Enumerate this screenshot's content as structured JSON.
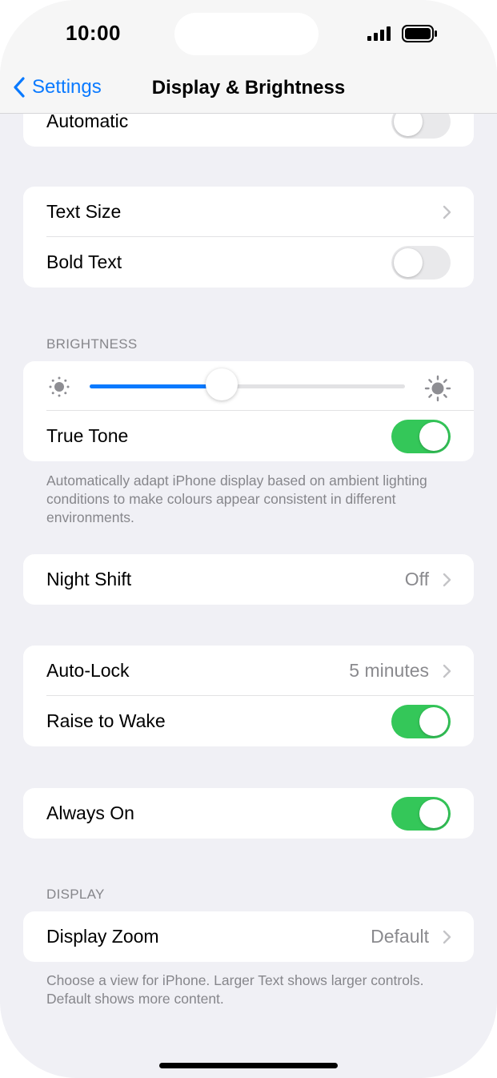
{
  "status_bar": {
    "time": "10:00"
  },
  "nav": {
    "back_label": "Settings",
    "title": "Display & Brightness"
  },
  "rows": {
    "automatic": {
      "label": "Automatic",
      "on": false
    },
    "text_size": {
      "label": "Text Size"
    },
    "bold_text": {
      "label": "Bold Text",
      "on": false
    },
    "true_tone": {
      "label": "True Tone",
      "on": true
    },
    "night_shift": {
      "label": "Night Shift",
      "value": "Off"
    },
    "auto_lock": {
      "label": "Auto-Lock",
      "value": "5 minutes"
    },
    "raise_to_wake": {
      "label": "Raise to Wake",
      "on": true
    },
    "always_on": {
      "label": "Always On",
      "on": true
    },
    "display_zoom": {
      "label": "Display Zoom",
      "value": "Default"
    }
  },
  "brightness": {
    "header": "BRIGHTNESS",
    "level_fraction": 0.42,
    "footnote": "Automatically adapt iPhone display based on ambient lighting conditions to make colours appear consistent in different environments."
  },
  "display": {
    "header": "DISPLAY",
    "footnote": "Choose a view for iPhone. Larger Text shows larger controls. Default shows more content."
  },
  "colors": {
    "accent": "#0a7aff",
    "toggle_on": "#34c759",
    "toggle_off": "#e9e9eb",
    "background": "#f0f0f5"
  }
}
